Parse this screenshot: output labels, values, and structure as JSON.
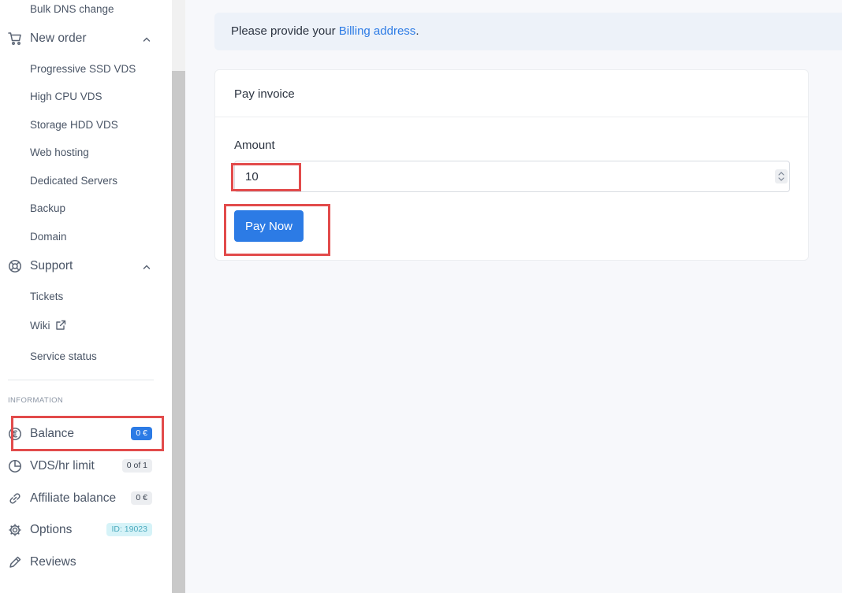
{
  "sidebar": {
    "top_item": "Bulk DNS change",
    "new_order": {
      "label": "New order",
      "items": [
        "Progressive SSD VDS",
        "High CPU VDS",
        "Storage HDD VDS",
        "Web hosting",
        "Dedicated Servers",
        "Backup",
        "Domain"
      ]
    },
    "support": {
      "label": "Support",
      "items": [
        "Tickets",
        "Wiki",
        "Service status"
      ]
    },
    "information_heading": "INFORMATION",
    "info": {
      "balance": {
        "label": "Balance",
        "badge": "0 €"
      },
      "vds_limit": {
        "label": "VDS/hr limit",
        "badge": "0 of 1"
      },
      "affiliate": {
        "label": "Affiliate balance",
        "badge": "0 €"
      },
      "options": {
        "label": "Options",
        "badge": "ID: 19023"
      },
      "reviews": {
        "label": "Reviews"
      }
    }
  },
  "notice": {
    "prefix": "Please provide your ",
    "link": "Billing address",
    "suffix": "."
  },
  "card": {
    "title": "Pay invoice",
    "amount_label": "Amount",
    "amount_value": "10",
    "pay_button": "Pay Now"
  },
  "colors": {
    "accent": "#2c7be5",
    "highlight": "#e24b4b",
    "text": "#2b3340",
    "muted": "#4a5566"
  },
  "icons": {
    "new_order": "cart-icon",
    "support": "lifebuoy-icon",
    "wiki": "external-link-icon",
    "balance": "euro-icon",
    "vds_limit": "pie-chart-icon",
    "affiliate": "link-icon",
    "options": "gear-icon",
    "reviews": "pencil-icon"
  }
}
